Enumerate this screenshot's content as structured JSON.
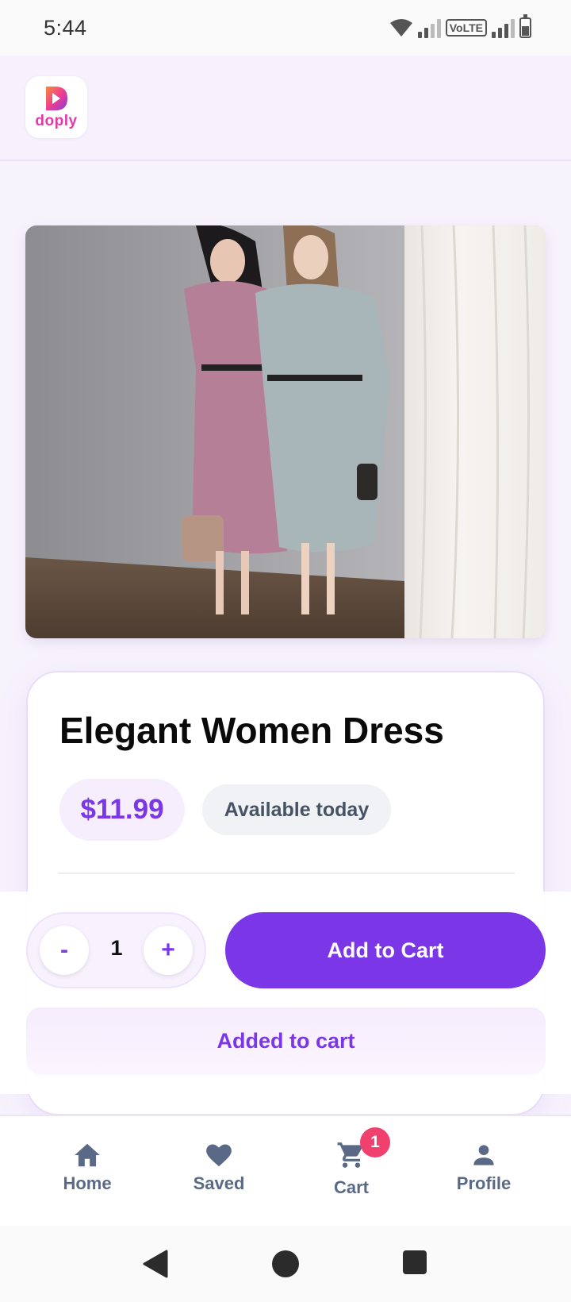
{
  "status_bar": {
    "time": "5:44",
    "volte": "VoLTE"
  },
  "header": {
    "logo_text": "doply"
  },
  "product": {
    "title": "Elegant Women Dress",
    "price": "$11.99",
    "availability": "Available today"
  },
  "actions": {
    "qty_minus": "-",
    "qty_value": "1",
    "qty_plus": "+",
    "add_to_cart": "Add to Cart",
    "added_message": "Added to cart"
  },
  "bottom_nav": {
    "items": [
      {
        "label": "Home",
        "icon": "home-icon"
      },
      {
        "label": "Saved",
        "icon": "heart-icon"
      },
      {
        "label": "Cart",
        "icon": "cart-icon",
        "badge": "1"
      },
      {
        "label": "Profile",
        "icon": "person-icon"
      }
    ]
  },
  "colors": {
    "accent": "#7b36e8",
    "badge": "#f0406e",
    "nav_text": "#5a6a86"
  }
}
